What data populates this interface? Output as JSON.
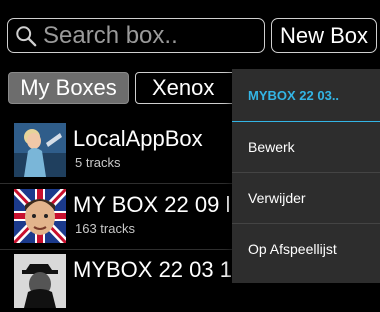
{
  "search": {
    "placeholder": "Search box.."
  },
  "toolbar": {
    "new_box_label": "New Box"
  },
  "tabs": [
    {
      "label": "My Boxes",
      "selected": true
    },
    {
      "label": "Xenox",
      "selected": false
    }
  ],
  "boxes": [
    {
      "title": "LocalAppBox",
      "subtitle": "5 tracks"
    },
    {
      "title": "MY BOX 22 09 l",
      "subtitle": "163 tracks"
    },
    {
      "title": "MYBOX 22 03 1"
    }
  ],
  "context_menu": {
    "title": "MYBOX 22 03..",
    "items": [
      {
        "label": "Bewerk"
      },
      {
        "label": "Verwijder"
      },
      {
        "label": "Op Afspeellijst"
      }
    ]
  },
  "colors": {
    "accent": "#33b5e5",
    "background": "#000000",
    "menu_background": "#2d2d2d"
  }
}
